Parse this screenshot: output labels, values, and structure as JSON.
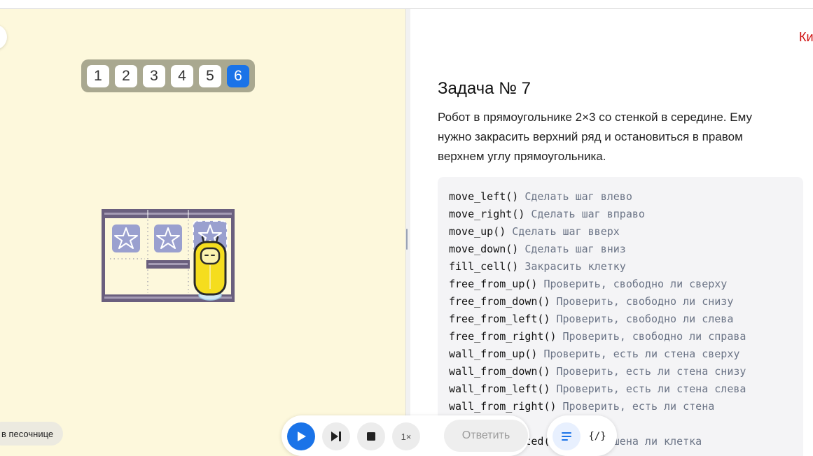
{
  "level_selector": {
    "levels": [
      "1",
      "2",
      "3",
      "4",
      "5",
      "6"
    ],
    "active_level": "6"
  },
  "board": {
    "rows": 2,
    "cols": 3,
    "cells_to_fill": 3
  },
  "sandbox_button": "в песочнице",
  "task": {
    "title": "Задача № 7",
    "description": "Робот в прямоугольнике 2×3 со стенкой в середине. Ему нужно закрасить верхний ряд и остановиться в правом верхнем углу прямоугольника."
  },
  "header_link_fragment": "Ки",
  "commands": [
    {
      "fn": "move_left()",
      "desc": "Сделать шаг влево"
    },
    {
      "fn": "move_right()",
      "desc": "Сделать шаг вправо"
    },
    {
      "fn": "move_up()",
      "desc": "Сделать шаг вверх"
    },
    {
      "fn": "move_down()",
      "desc": "Сделать шаг вниз"
    },
    {
      "fn": "fill_cell()",
      "desc": "Закрасить клетку"
    },
    {
      "fn": "free_from_up()",
      "desc": "Проверить, свободно ли сверху"
    },
    {
      "fn": "free_from_down()",
      "desc": "Проверить, свободно ли снизу"
    },
    {
      "fn": "free_from_left()",
      "desc": "Проверить, свободно ли слева"
    },
    {
      "fn": "free_from_right()",
      "desc": "Проверить, свободно ли справа"
    },
    {
      "fn": "wall_from_up()",
      "desc": "Проверить, есть ли стена сверху"
    },
    {
      "fn": "wall_from_down()",
      "desc": "Проверить, есть ли стена снизу"
    },
    {
      "fn": "wall_from_left()",
      "desc": "Проверить, есть ли стена слева"
    },
    {
      "fn": "wall_from_right()",
      "desc": "Проверить, есть ли стена"
    },
    {
      "fn": "",
      "desc": ""
    },
    {
      "fn": "fill_is_painted()",
      "desc": "ь, закрашена ли клетка"
    }
  ],
  "controls": {
    "play_icon": "play-icon",
    "step_icon": "step-forward-icon",
    "stop_icon": "stop-icon",
    "speed_label": "1×",
    "answer_label": "Ответить"
  },
  "view_toggle": {
    "text_icon": "text-lines-icon",
    "code_icon": "code-braces-icon",
    "code_glyph": "{/}"
  },
  "colors": {
    "accent": "#1a73e8",
    "left_bg": "#fdf8dc",
    "wall": "#6a5f7e",
    "star_tile": "#9aa0cf",
    "robot": "#f5dd1e"
  }
}
